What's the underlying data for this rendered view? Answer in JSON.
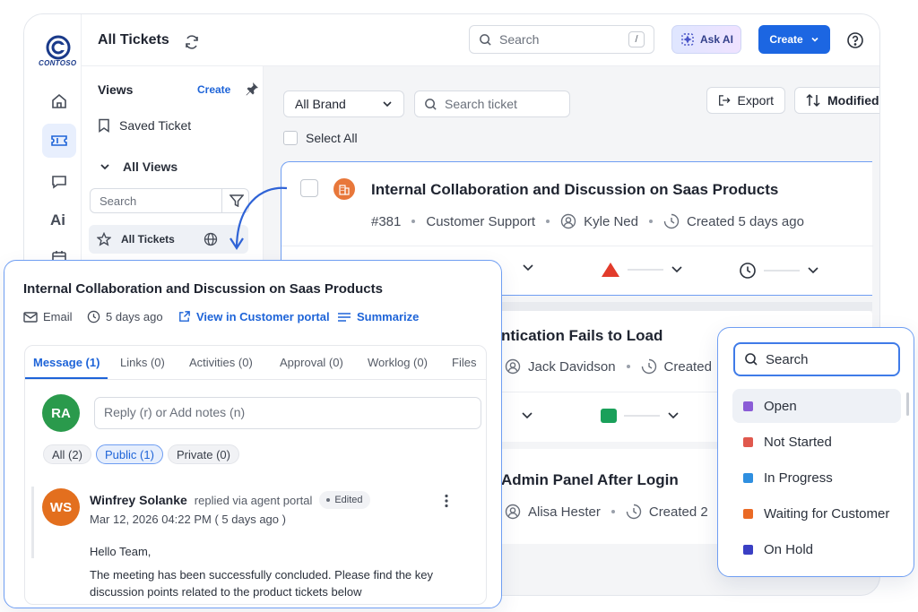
{
  "header": {
    "title": "All Tickets",
    "search_placeholder": "Search",
    "search_shortcut": "/",
    "ask_ai_label": "Ask AI",
    "create_label": "Create",
    "logo_text": "CONTOSO"
  },
  "rail": {
    "ai_label": "Ai"
  },
  "views": {
    "title": "Views",
    "create_label": "Create",
    "saved_ticket_label": "Saved Ticket",
    "all_views_label": "All Views",
    "search_placeholder": "Search",
    "all_tickets_label": "All Tickets"
  },
  "toolbar": {
    "brand_label": "All Brand",
    "search_ticket_placeholder": "Search ticket",
    "export_label": "Export",
    "sort_label": "Modified",
    "select_all_label": "Select All"
  },
  "tickets": [
    {
      "title": "Internal Collaboration and Discussion on Saas Products",
      "id": "#381",
      "group": "Customer Support",
      "agent": "Kyle Ned",
      "created": "Created 5 days ago"
    },
    {
      "title_partial": "ntication Fails to Load",
      "agent": "Jack Davidson",
      "created_partial": "Created"
    },
    {
      "title_partial": "Admin Panel After Login",
      "agent": "Alisa Hester",
      "created_partial": "Created 2"
    }
  ],
  "detail": {
    "title": "Internal Collaboration and Discussion on Saas Products",
    "channel": "Email",
    "age": "5 days ago",
    "portal_link": "View in Customer portal",
    "summarize_label": "Summarize",
    "tabs": [
      "Message (1)",
      "Links (0)",
      "Activities (0)",
      "Approval (0)",
      "Worklog (0)",
      "Files"
    ],
    "reply_avatar": "RA",
    "reply_placeholder": "Reply (r) or Add notes (n)",
    "filters": [
      "All (2)",
      "Public (1)",
      "Private (0)"
    ],
    "message": {
      "avatar": "WS",
      "author": "Winfrey Solanke",
      "via": "replied via agent portal",
      "badge": "Edited",
      "timestamp": "Mar 12, 2026 04:22 PM ( 5 days ago )",
      "greeting": "Hello Team,",
      "body_line1": "The meeting has been successfully concluded. Please find the key",
      "body_line2": "discussion points related to the product tickets below"
    }
  },
  "status_menu": {
    "search_placeholder": "Search",
    "options": [
      {
        "label": "Open",
        "color": "#8a5cd6"
      },
      {
        "label": "Not Started",
        "color": "#e0584d"
      },
      {
        "label": "In Progress",
        "color": "#2f8fe0"
      },
      {
        "label": "Waiting for Customer",
        "color": "#ea6a25"
      },
      {
        "label": "On Hold",
        "color": "#3a3fc4"
      }
    ]
  },
  "colors": {
    "primary": "#1c66e2",
    "priority_high": "#e23b2b",
    "priority_low": "#1aa05a",
    "avatar_ra": "#2a9a4c",
    "avatar_ws": "#e36f1e"
  }
}
